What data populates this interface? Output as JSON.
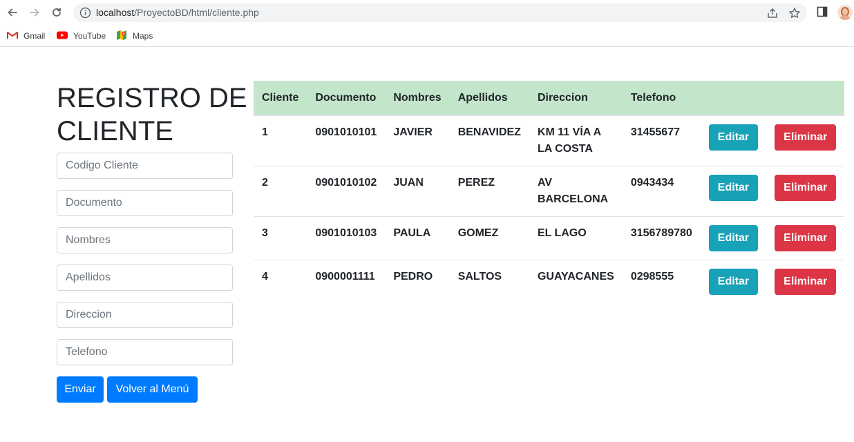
{
  "browser": {
    "url_host": "localhost",
    "url_path": "/ProyectoBD/html/cliente.php",
    "bookmarks": [
      {
        "label": "Gmail",
        "icon": "gmail-icon"
      },
      {
        "label": "YouTube",
        "icon": "youtube-icon"
      },
      {
        "label": "Maps",
        "icon": "maps-icon"
      }
    ]
  },
  "form": {
    "title": "REGISTRO DE CLIENTE",
    "fields": [
      {
        "placeholder": "Codigo Cliente",
        "value": ""
      },
      {
        "placeholder": "Documento",
        "value": ""
      },
      {
        "placeholder": "Nombres",
        "value": ""
      },
      {
        "placeholder": "Apellidos",
        "value": ""
      },
      {
        "placeholder": "Direccion",
        "value": ""
      },
      {
        "placeholder": "Telefono",
        "value": ""
      }
    ],
    "submit_label": "Enviar",
    "back_label": "Volver al Menú"
  },
  "table": {
    "header_color": "#c3e6cb",
    "columns": [
      "Cliente",
      "Documento",
      "Nombres",
      "Apellidos",
      "Direccion",
      "Telefono"
    ],
    "edit_label": "Editar",
    "delete_label": "Eliminar",
    "rows": [
      [
        "1",
        "0901010101",
        "JAVIER",
        "BENAVIDEZ",
        "KM 11 VÍA A LA COSTA",
        "31455677"
      ],
      [
        "2",
        "0901010102",
        "JUAN",
        "PEREZ",
        "AV BARCELONA",
        "0943434"
      ],
      [
        "3",
        "0901010103",
        "PAULA",
        "GOMEZ",
        "EL LAGO",
        "3156789780"
      ],
      [
        "4",
        "0900001111",
        "PEDRO",
        "SALTOS",
        "GUAYACANES",
        "0298555"
      ]
    ]
  },
  "colors": {
    "primary": "#007bff",
    "info": "#17a2b8",
    "danger": "#dc3545"
  }
}
